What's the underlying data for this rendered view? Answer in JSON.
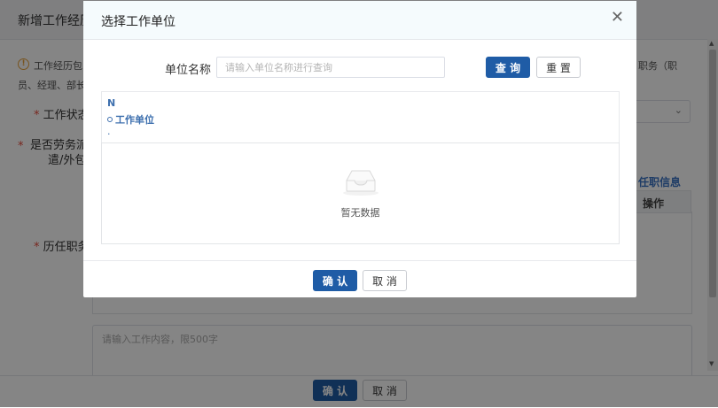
{
  "background_dialog": {
    "title": "新增工作经历",
    "tip_line1": "工作经历包",
    "tip_line1_right": "职务（职",
    "tip_line2": "员、经理、部长",
    "fields": {
      "work_status_label": "工作状态",
      "dispatch_label_line1": "是否劳务派",
      "dispatch_label_line2": "遣/外包",
      "history_positions_label": "历任职务"
    },
    "history_link": "任职信息",
    "table_header_action": "操作",
    "content_placeholder": "请输入工作内容，限500字",
    "footer": {
      "confirm_label": "确 认",
      "cancel_label": "取 消"
    }
  },
  "modal": {
    "title": "选择工作单位",
    "close_icon": "close-icon",
    "search": {
      "label": "单位名称",
      "placeholder": "请输入单位名称进行查询",
      "value": "",
      "query_label": "查 询",
      "reset_label": "重 置"
    },
    "tree": {
      "root": "N",
      "node": "工作单位",
      "trailing": "."
    },
    "table": {
      "empty_icon": "empty-inbox-icon",
      "empty_text": "暂无数据"
    },
    "footer": {
      "confirm_label": "确 认",
      "cancel_label": "取 消"
    }
  },
  "colors": {
    "primary": "#1f5ca6",
    "link": "#3b73c4",
    "required": "#e74c3c",
    "warning": "#e6a23c",
    "mask": "rgba(0,0,0,0.48)"
  }
}
